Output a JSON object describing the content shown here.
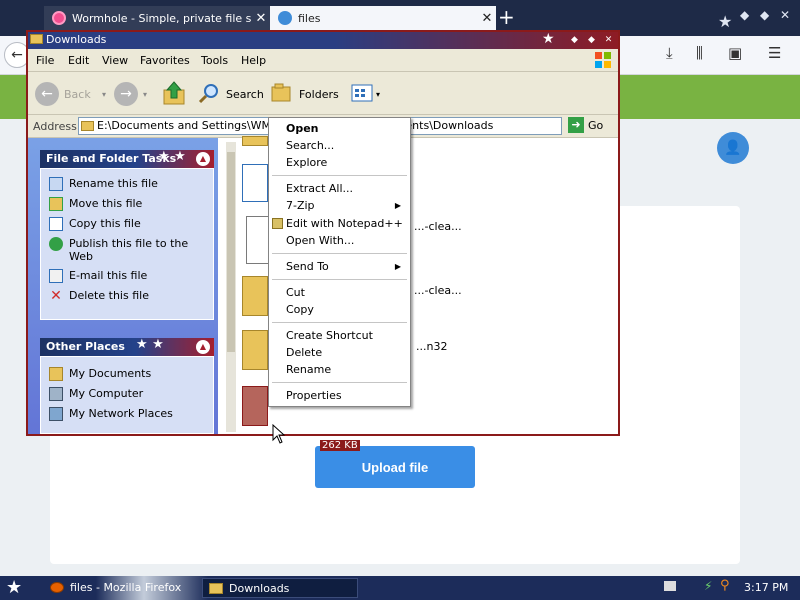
{
  "browser": {
    "tabs": [
      {
        "title": "Wormhole - Simple, private file sh...",
        "active": false
      },
      {
        "title": "files",
        "active": true
      }
    ],
    "new_tab_glyph": "+",
    "toolbar_icons": [
      "download-icon",
      "library-icon",
      "sidebar-icon",
      "menu-icon"
    ]
  },
  "webpage": {
    "upload_button_label": "Upload file",
    "accent_color": "#3a8ee6",
    "band_color": "#79b342"
  },
  "explorer": {
    "title": "Downloads",
    "menu": [
      "File",
      "Edit",
      "View",
      "Favorites",
      "Tools",
      "Help"
    ],
    "toolbar": {
      "back_label": "Back",
      "search_label": "Search",
      "folders_label": "Folders"
    },
    "address": {
      "label": "Address",
      "path": "E:\\Documents and Settings\\WM2.COMPUTER\\My Documents\\Downloads",
      "go_label": "Go"
    },
    "file_tasks": {
      "header": "File and Folder Tasks",
      "items": [
        "Rename this file",
        "Move this file",
        "Copy this file",
        "Publish this file to the Web",
        "E-mail this file",
        "Delete this file"
      ]
    },
    "other_places": {
      "header": "Other Places",
      "items": [
        "My Documents",
        "My Computer",
        "My Network Places"
      ]
    },
    "files": [
      {
        "name": "...-clea..."
      },
      {
        "name": "...-clea..."
      },
      {
        "name": "...n32"
      },
      {
        "name": "",
        "size": "262 KB"
      }
    ]
  },
  "context_menu": {
    "items": [
      {
        "label": "Open",
        "bold": true
      },
      {
        "label": "Search..."
      },
      {
        "label": "Explore"
      },
      {
        "label": "Extract All..."
      },
      {
        "label": "7-Zip",
        "submenu": true
      },
      {
        "label": "Edit with Notepad++"
      },
      {
        "label": "Open With..."
      },
      {
        "label": "Send To",
        "submenu": true
      },
      {
        "label": "Cut"
      },
      {
        "label": "Copy"
      },
      {
        "label": "Create Shortcut"
      },
      {
        "label": "Delete"
      },
      {
        "label": "Rename"
      },
      {
        "label": "Properties"
      }
    ]
  },
  "taskbar": {
    "apps": [
      {
        "label": "files - Mozilla Firefox"
      },
      {
        "label": "Downloads"
      }
    ],
    "clock": "3:17 PM"
  }
}
